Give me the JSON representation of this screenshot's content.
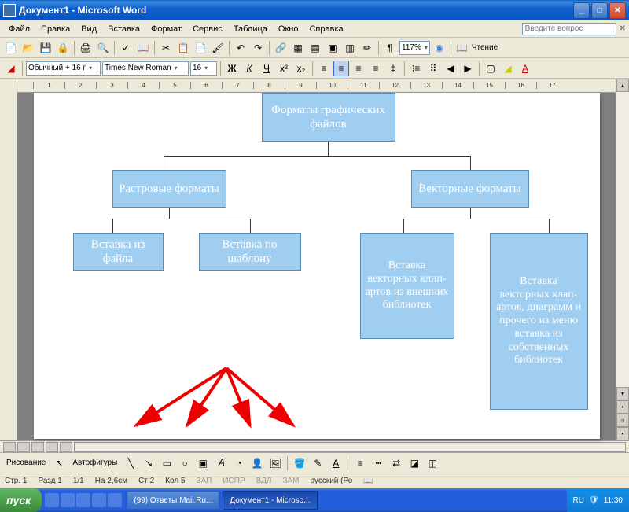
{
  "titlebar": {
    "title": "Документ1 - Microsoft Word"
  },
  "menu": {
    "items": [
      "Файл",
      "Правка",
      "Вид",
      "Вставка",
      "Формат",
      "Сервис",
      "Таблица",
      "Окно",
      "Справка"
    ],
    "helpbox_placeholder": "Введите вопрос"
  },
  "toolbar1": {
    "zoom": "117%",
    "read_label": "Чтение"
  },
  "toolbar2": {
    "style": "Обычный + 16 г",
    "font": "Times New Roman",
    "size": "16"
  },
  "ruler_ticks": [
    "1",
    "2",
    "3",
    "4",
    "5",
    "6",
    "7",
    "8",
    "9",
    "10",
    "11",
    "12",
    "13",
    "14",
    "15",
    "16",
    "17"
  ],
  "diagram": {
    "root": "Форматы графических файлов",
    "left": "Растровые форматы",
    "right": "Векторные форматы",
    "l1": "Вставка из файла",
    "l2": "Вставка по шаблону",
    "r1": "Вставка векторных клип-артов из внешних библиотек",
    "r2": "Вставка векторных клап-артов, диаграмм и прочего из меню вставка из собственных библиотек"
  },
  "drawbar": {
    "draw_label": "Рисование",
    "autoshapes_label": "Автофигуры"
  },
  "statusbar": {
    "page": "Стр. 1",
    "section": "Разд 1",
    "pages": "1/1",
    "at": "На 2,6см",
    "line": "Ст 2",
    "col": "Кол 5",
    "rec": "ЗАП",
    "trk": "ИСПР",
    "ext": "ВДЛ",
    "ovr": "ЗАМ",
    "lang": "русский (Ро"
  },
  "taskbar": {
    "start": "пуск",
    "tasks": [
      "(99) Ответы Mail.Ru...",
      "Документ1 - Microso..."
    ],
    "lang": "RU",
    "time": "11:30"
  }
}
